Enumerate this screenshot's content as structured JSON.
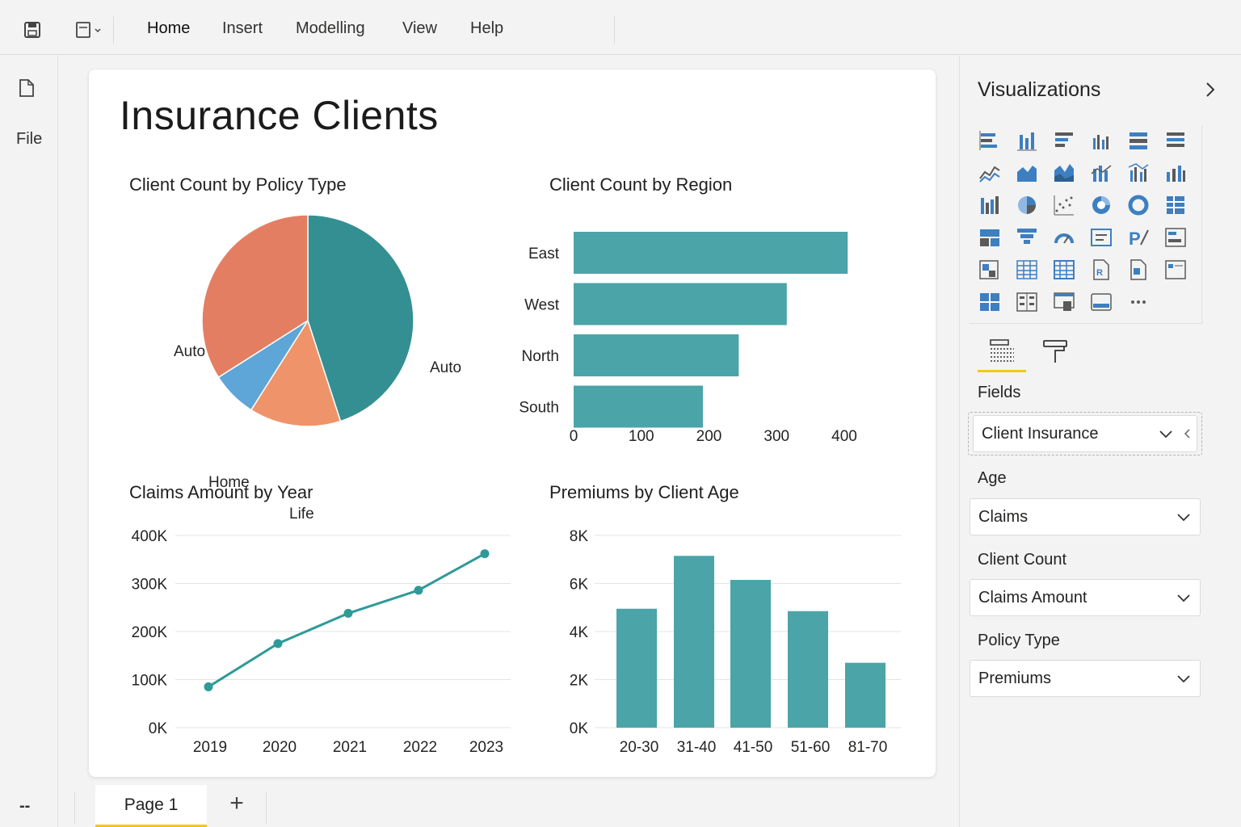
{
  "ribbon": {
    "tabs": [
      {
        "label": "Home"
      },
      {
        "label": "Insert"
      },
      {
        "label": "Modelling"
      },
      {
        "label": "View"
      },
      {
        "label": "Help"
      }
    ]
  },
  "left_rail": {
    "file_label": "File",
    "bottom_label": "--"
  },
  "report": {
    "title": "Insurance Clients"
  },
  "visuals": {
    "pie": {
      "title": "Client Count by Policy Type",
      "chart_data": {
        "type": "pie",
        "slices": [
          {
            "label": "Auto",
            "value": 45,
            "color": "#338f92"
          },
          {
            "label": "Life",
            "value": 14,
            "color": "#ef946a"
          },
          {
            "label": "Home",
            "value": 7,
            "color": "#5ea5d8"
          },
          {
            "label": "Auto",
            "value": 34,
            "color": "#e47e62"
          }
        ]
      }
    },
    "region": {
      "title": "Client Count by Region",
      "chart_data": {
        "type": "bar",
        "orientation": "horizontal",
        "categories": [
          "East",
          "West",
          "North",
          "South"
        ],
        "values": [
          405,
          315,
          244,
          191
        ],
        "xlim": [
          0,
          400
        ],
        "xticks": [
          "0",
          "100",
          "200",
          "300",
          "400"
        ],
        "color": "#4aa4a8"
      }
    },
    "claims": {
      "title": "Claims Amount by Year",
      "chart_data": {
        "type": "line",
        "x": [
          "2019",
          "2020",
          "2021",
          "2022",
          "2023"
        ],
        "values": [
          85000,
          175000,
          238000,
          286000,
          362000
        ],
        "ylim": [
          0,
          400000
        ],
        "yticks": [
          "0K",
          "100K",
          "200K",
          "300K",
          "400K"
        ],
        "grid": true,
        "color": "#2f9a98"
      }
    },
    "premiums": {
      "title": "Premiums by Client Age",
      "chart_data": {
        "type": "bar",
        "categories": [
          "20-30",
          "31-40",
          "41-50",
          "51-60",
          "81-70"
        ],
        "values": [
          4950,
          7150,
          6150,
          4850,
          2700
        ],
        "ylim": [
          0,
          8000
        ],
        "yticks": [
          "0K",
          "2K",
          "4K",
          "6K",
          "8K"
        ],
        "grid": true,
        "color": "#4aa4a8"
      }
    }
  },
  "page_tabs": {
    "active": "Page 1",
    "add": "+"
  },
  "pane": {
    "title": "Visualizations",
    "fields_heading": "Fields",
    "dataset": "Client Insurance",
    "wells": [
      {
        "heading": "Age",
        "value": "Claims"
      },
      {
        "heading": "Client Count",
        "value": "Claims Amount"
      },
      {
        "heading": "Policy Type",
        "value": "Premiums"
      }
    ],
    "viz_icons": [
      "stacked-bar-icon",
      "stacked-column-icon",
      "clustered-bar-icon",
      "clustered-column-icon",
      "100-bar-icon",
      "100-column-icon",
      "line-chart-icon",
      "area-chart-icon",
      "stacked-area-icon",
      "line-column-icon",
      "line-clustered-column-icon",
      "ribbon-chart-icon",
      "waterfall-icon",
      "pie-chart-icon",
      "scatter-icon",
      "donut-icon",
      "donut-ring-icon",
      "treemap-icon",
      "map-icon",
      "funnel-icon",
      "gauge-icon",
      "card-icon",
      "kpi-icon",
      "multi-row-card-icon",
      "slicer-icon",
      "table-icon",
      "matrix-icon",
      "r-visual-icon",
      "python-visual-icon",
      "key-influencers-icon",
      "decomposition-tree-icon",
      "qa-icon",
      "smart-narrative-icon",
      "paginated-report-icon",
      "more-visuals-icon"
    ]
  }
}
